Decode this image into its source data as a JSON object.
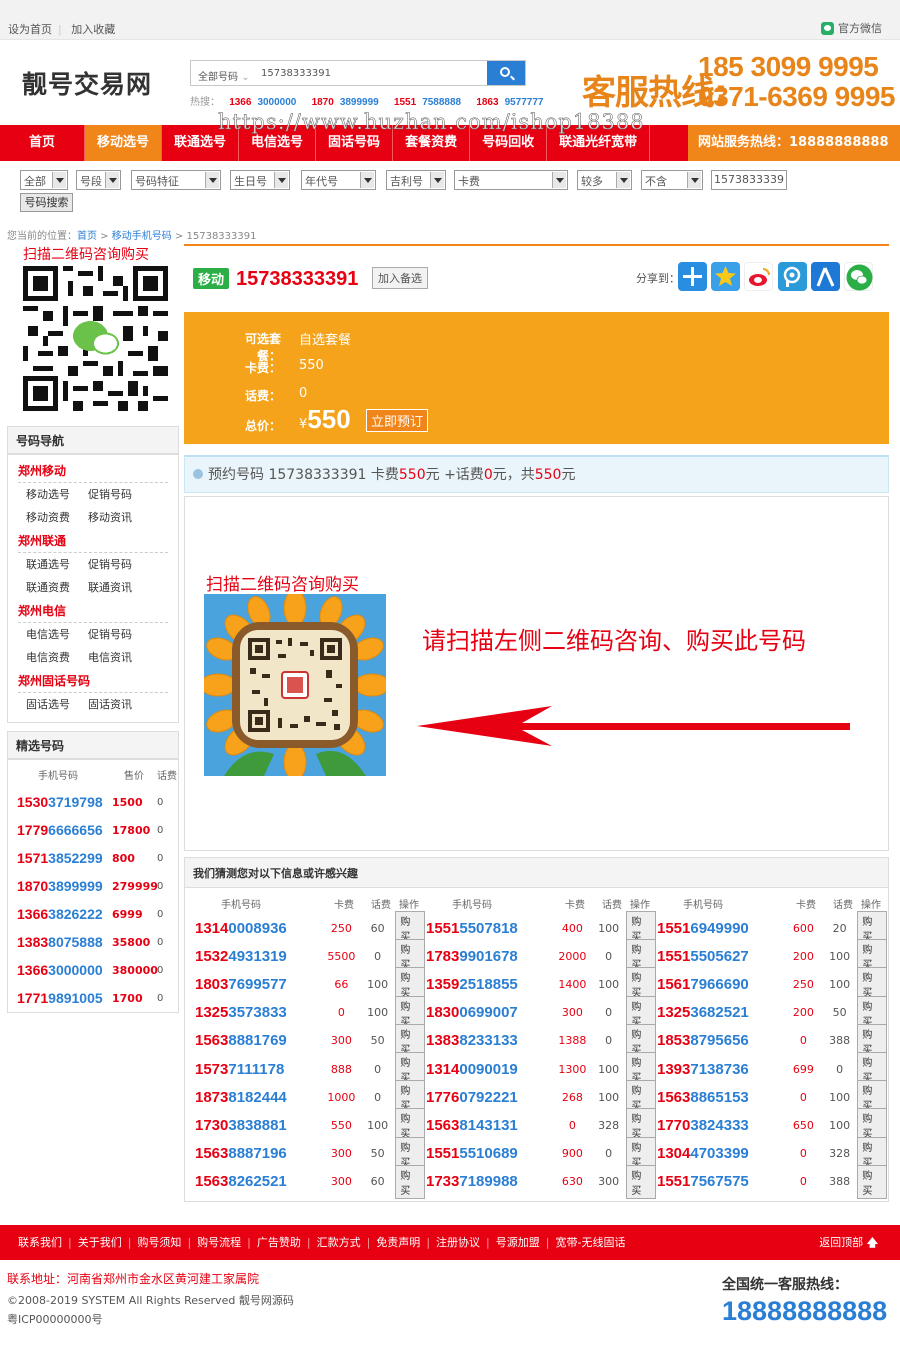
{
  "topbar": {
    "set_home": "设为首页",
    "favorite": "加入收藏",
    "wechat": "官方微信"
  },
  "logo": "靓号交易网",
  "search": {
    "select": "全部号码",
    "value": "15738333391"
  },
  "hot": {
    "label": "热搜：",
    "items": [
      {
        "a": "1366",
        "b": "3000000"
      },
      {
        "a": "1870",
        "b": "3899999"
      },
      {
        "a": "1551",
        "b": "7588888"
      },
      {
        "a": "1863",
        "b": "9577777"
      }
    ]
  },
  "hotline": {
    "label": "客服热线:",
    "num1": "185 3099 9995",
    "num2": "0371-6369 9995"
  },
  "nav": {
    "items": [
      "首页",
      "移动选号",
      "联通选号",
      "电信选号",
      "固话号码",
      "套餐资费",
      "号码回收",
      "联通光纤宽带"
    ],
    "service": "网站服务热线：18888888888"
  },
  "watermark": "https://www.huzhan.com/ishop18388",
  "filters": {
    "selects": [
      "全部",
      "号段",
      "号码特征",
      "生日号",
      "年代号",
      "吉利号",
      "卡费",
      "较多",
      "不含"
    ],
    "input": "1573833339",
    "button": "号码搜索"
  },
  "breadcrumb": {
    "label": "您当前的位置：",
    "home": "首页",
    "cat": "移动手机号码",
    "current": "15738333391"
  },
  "left": {
    "qr_title": "扫描二维码咨询购买",
    "nav_title": "号码导航",
    "groups": [
      {
        "title": "郑州移动",
        "rows": [
          [
            "移动选号",
            "促销号码"
          ],
          [
            "移动资费",
            "移动资讯"
          ]
        ]
      },
      {
        "title": "郑州联通",
        "rows": [
          [
            "联通选号",
            "促销号码"
          ],
          [
            "联通资费",
            "联通资讯"
          ]
        ]
      },
      {
        "title": "郑州电信",
        "rows": [
          [
            "电信选号",
            "促销号码"
          ],
          [
            "电信资费",
            "电信资讯"
          ]
        ]
      },
      {
        "title": "郑州固话号码",
        "rows": [
          [
            "固话选号",
            "固话资讯"
          ]
        ]
      }
    ],
    "picks_title": "精选号码",
    "picks_head": [
      "手机号码",
      "售价",
      "话费"
    ],
    "picks": [
      {
        "a": "1530",
        "b": "3719798",
        "price": "1500",
        "fee": "0"
      },
      {
        "a": "1779",
        "b": "6666656",
        "price": "17800",
        "fee": "0"
      },
      {
        "a": "1571",
        "b": "3852299",
        "price": "800",
        "fee": "0"
      },
      {
        "a": "1870",
        "b": "3899999",
        "price": "279999",
        "fee": "0"
      },
      {
        "a": "1366",
        "b": "3826222",
        "price": "6999",
        "fee": "0"
      },
      {
        "a": "1383",
        "b": "8075888",
        "price": "35800",
        "fee": "0"
      },
      {
        "a": "1366",
        "b": "3000000",
        "price": "380000",
        "fee": "0"
      },
      {
        "a": "1771",
        "b": "9891005",
        "price": "1700",
        "fee": "0"
      }
    ]
  },
  "detail": {
    "carrier": "移动",
    "number": "15738333391",
    "add_fav": "加入备选",
    "share": "分享到："
  },
  "price": {
    "k1": "可选套餐：",
    "v1": "自选套餐",
    "k2": "卡费：",
    "v2": "550",
    "k3": "话费：",
    "v3": "0",
    "k4": "总价：",
    "currency": "¥",
    "total": "550",
    "buy": "立即预订"
  },
  "booking": {
    "p1": "预约号码 15738333391 卡费",
    "fee": "550",
    "p2": "元 +话费",
    "tel": "0",
    "p3": "元，共",
    "total": "550",
    "p4": "元"
  },
  "qrarea": {
    "title": "扫描二维码咨询购买",
    "msg": "请扫描左侧二维码咨询、购买此号码"
  },
  "recommend": {
    "title": "我们猜测您对以下信息或许感兴趣",
    "head": [
      "手机号码",
      "卡费",
      "话费",
      "操作"
    ],
    "buy": "购买",
    "rows": [
      [
        {
          "a": "1314",
          "b": "0008936",
          "fee": "250",
          "tel": "60"
        },
        {
          "a": "1551",
          "b": "5507818",
          "fee": "400",
          "tel": "100"
        },
        {
          "a": "1551",
          "b": "6949990",
          "fee": "600",
          "tel": "20"
        }
      ],
      [
        {
          "a": "1532",
          "b": "4931319",
          "fee": "5500",
          "tel": "0"
        },
        {
          "a": "1783",
          "b": "9901678",
          "fee": "2000",
          "tel": "0"
        },
        {
          "a": "1551",
          "b": "5505627",
          "fee": "200",
          "tel": "100"
        }
      ],
      [
        {
          "a": "1803",
          "b": "7699577",
          "fee": "66",
          "tel": "100"
        },
        {
          "a": "1359",
          "b": "2518855",
          "fee": "1400",
          "tel": "100"
        },
        {
          "a": "1561",
          "b": "7966690",
          "fee": "250",
          "tel": "100"
        }
      ],
      [
        {
          "a": "1325",
          "b": "3573833",
          "fee": "0",
          "tel": "100"
        },
        {
          "a": "1830",
          "b": "0699007",
          "fee": "300",
          "tel": "0"
        },
        {
          "a": "1325",
          "b": "3682521",
          "fee": "200",
          "tel": "50"
        }
      ],
      [
        {
          "a": "1563",
          "b": "8881769",
          "fee": "300",
          "tel": "50"
        },
        {
          "a": "1383",
          "b": "8233133",
          "fee": "1388",
          "tel": "0"
        },
        {
          "a": "1853",
          "b": "8795656",
          "fee": "0",
          "tel": "388"
        }
      ],
      [
        {
          "a": "1573",
          "b": "7111178",
          "fee": "888",
          "tel": "0"
        },
        {
          "a": "1314",
          "b": "0090019",
          "fee": "1300",
          "tel": "100"
        },
        {
          "a": "1393",
          "b": "7138736",
          "fee": "699",
          "tel": "0"
        }
      ],
      [
        {
          "a": "1873",
          "b": "8182444",
          "fee": "1000",
          "tel": "0"
        },
        {
          "a": "1776",
          "b": "0792221",
          "fee": "268",
          "tel": "100"
        },
        {
          "a": "1563",
          "b": "8865153",
          "fee": "0",
          "tel": "100"
        }
      ],
      [
        {
          "a": "1730",
          "b": "3838881",
          "fee": "550",
          "tel": "100"
        },
        {
          "a": "1563",
          "b": "8143131",
          "fee": "0",
          "tel": "328"
        },
        {
          "a": "1770",
          "b": "3824333",
          "fee": "650",
          "tel": "100"
        }
      ],
      [
        {
          "a": "1563",
          "b": "8887196",
          "fee": "300",
          "tel": "50"
        },
        {
          "a": "1551",
          "b": "5510689",
          "fee": "900",
          "tel": "0"
        },
        {
          "a": "1304",
          "b": "4703399",
          "fee": "0",
          "tel": "328"
        }
      ],
      [
        {
          "a": "1563",
          "b": "8262521",
          "fee": "300",
          "tel": "60"
        },
        {
          "a": "1733",
          "b": "7189988",
          "fee": "630",
          "tel": "300"
        },
        {
          "a": "1551",
          "b": "7567575",
          "fee": "0",
          "tel": "388"
        }
      ]
    ]
  },
  "footer": {
    "links": [
      "联系我们",
      "关于我们",
      "购号须知",
      "购号流程",
      "广告赞助",
      "汇款方式",
      "免责声明",
      "注册协议",
      "号源加盟",
      "宽带-无线固话"
    ],
    "backtop": "返回顶部",
    "address": "联系地址：河南省郑州市金水区黄河建工家属院",
    "copyright": "©2008-2019 SYSTEM All Rights Reserved 靓号网源码",
    "icp": "粤ICP00000000号",
    "hotline_label": "全国统一客服热线：",
    "hotline": "18888888888"
  },
  "colors": {
    "red": "#e60012",
    "orange": "#f08519",
    "blue": "#2a7fd4",
    "price_bg": "#f5a31a"
  }
}
